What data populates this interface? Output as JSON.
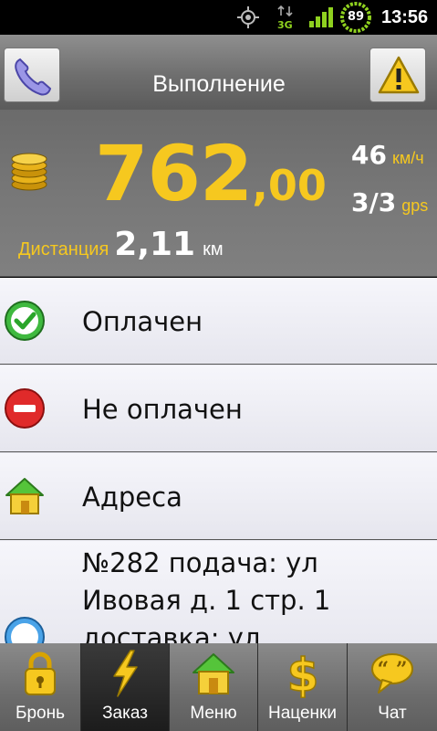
{
  "status_bar": {
    "icons": [
      "gps-icon",
      "3g-data-icon",
      "signal-icon",
      "battery-icon"
    ],
    "network": "3G",
    "battery": "89",
    "time": "13:56"
  },
  "header": {
    "title": "Выполнение",
    "left_button_icon": "phone-icon",
    "right_button_icon": "warning-icon"
  },
  "meter": {
    "price_int": "762",
    "price_frac": ",00",
    "speed_value": "46",
    "speed_unit": "км/ч",
    "gps_value": "3/3",
    "gps_unit": "gps",
    "distance_label": "Дистанция",
    "distance_value": "2,11",
    "distance_unit": "км",
    "accent_color": "#f6c81f"
  },
  "list": {
    "paid": {
      "label": "Оплачен",
      "icon": "check-circle-icon"
    },
    "unpaid": {
      "label": "Не оплачен",
      "icon": "minus-circle-icon"
    },
    "addresses": {
      "label": "Адреса",
      "icon": "house-icon"
    },
    "order_info": {
      "text": "№282 подача: ул\nИвовая д. 1 стр. 1\nдоставка: ул",
      "icon": "info-icon"
    }
  },
  "tabs": [
    {
      "label": "Бронь",
      "icon": "lock-icon"
    },
    {
      "label": "Заказ",
      "icon": "lightning-icon",
      "active": true
    },
    {
      "label": "Меню",
      "icon": "house-icon"
    },
    {
      "label": "Наценки",
      "icon": "dollar-icon"
    },
    {
      "label": "Чат",
      "icon": "chat-bubble-icon"
    }
  ]
}
